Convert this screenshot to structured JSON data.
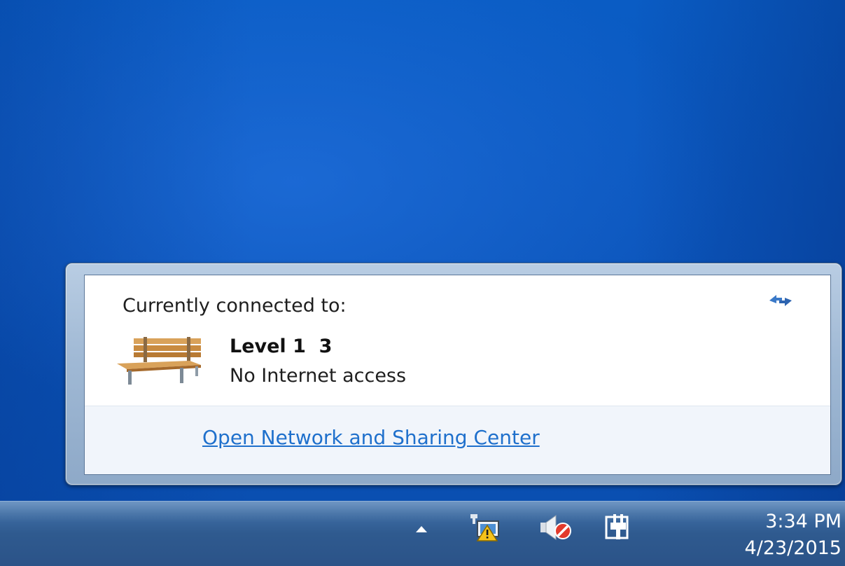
{
  "network_flyout": {
    "title": "Currently connected to:",
    "connection": {
      "name": "Level 1  3",
      "status": "No Internet access",
      "icon": "park-bench-icon"
    },
    "refresh_icon": "refresh-arrows-icon",
    "footer_link": "Open Network and Sharing Center"
  },
  "taskbar": {
    "tray_icons": [
      "show-hidden-icons-arrow",
      "network-warning-icon",
      "volume-muted-icon",
      "power-plug-icon"
    ],
    "time": "3:34 PM",
    "date": "4/23/2015"
  },
  "colors": {
    "desktop": "#0b56bd",
    "link": "#1f70cc",
    "taskbar": "#2f5a8f"
  }
}
